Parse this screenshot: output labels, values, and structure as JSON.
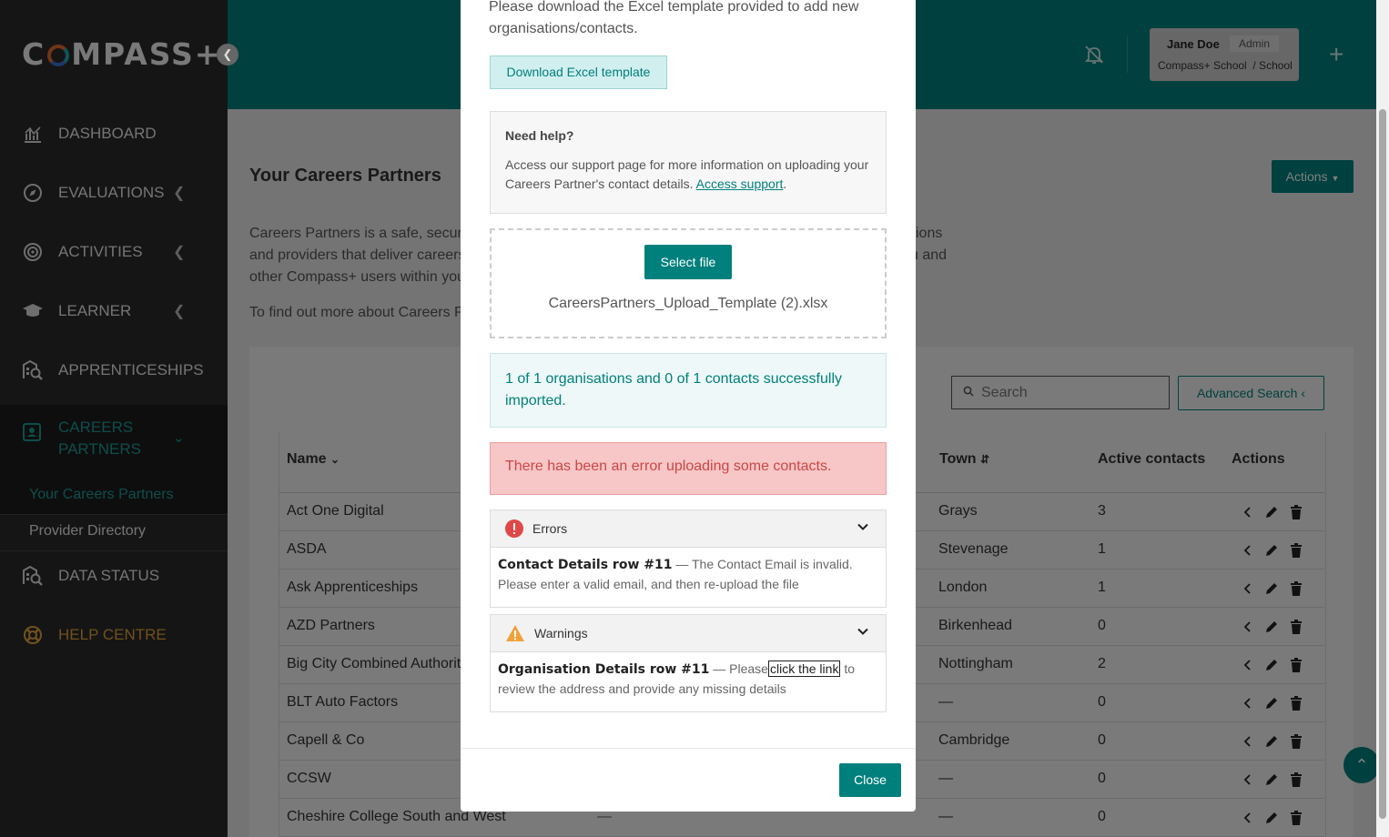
{
  "brand": {
    "logo_left": "C",
    "logo_right": "MPASS+"
  },
  "sidebar": {
    "items": [
      {
        "label": "DASHBOARD",
        "icon": "chart-icon"
      },
      {
        "label": "EVALUATIONS",
        "icon": "compass-icon"
      },
      {
        "label": "ACTIVITIES",
        "icon": "target-icon"
      },
      {
        "label": "LEARNER",
        "icon": "graduation-cap-icon"
      },
      {
        "label": "APPRENTICESHIPS",
        "icon": "building-search-icon"
      },
      {
        "label": "CAREERS PARTNERS",
        "icon": "contact-card-icon"
      },
      {
        "label": "DATA STATUS",
        "icon": "building-search-icon"
      },
      {
        "label": "HELP CENTRE",
        "icon": "lifebuoy-icon"
      }
    ],
    "sub_items": [
      "Your Careers Partners",
      "Provider Directory"
    ]
  },
  "header": {
    "user_name": "Jane Doe",
    "user_role": "Admin",
    "user_school": "Compass+ School",
    "user_school_suffix": "/ School"
  },
  "page": {
    "title": "Your Careers Partners",
    "actions_label": "Actions",
    "intro_lines": [
      {
        "left": "Careers Partners is a safe, secur",
        "right": "ions"
      },
      {
        "left": "and providers that deliver careers",
        "right": "u and"
      },
      {
        "left": "other Compass+ users within you",
        "right": ""
      }
    ],
    "find_out": "To find out more about Careers P",
    "search_placeholder": "Search",
    "advanced_search": "Advanced Search"
  },
  "table": {
    "headers": {
      "name": "Name",
      "town": "Town",
      "active_contacts": "Active contacts",
      "actions": "Actions"
    },
    "rows": [
      {
        "name": "Act One Digital",
        "town": "Grays",
        "contacts": "3"
      },
      {
        "name": "ASDA",
        "town": "Stevenage",
        "contacts": "1"
      },
      {
        "name": "Ask Apprenticeships",
        "town": "London",
        "contacts": "1"
      },
      {
        "name": "AZD Partners",
        "town": "Birkenhead",
        "contacts": "0"
      },
      {
        "name": "Big City Combined Authorit",
        "town": "Nottingham",
        "contacts": "2"
      },
      {
        "name": "BLT Auto Factors",
        "town": "—",
        "contacts": "0"
      },
      {
        "name": "Capell & Co",
        "town": "Cambridge",
        "contacts": "0"
      },
      {
        "name": "CCSW",
        "town": "—",
        "contacts": "0"
      },
      {
        "name": "Cheshire College South and West",
        "extra": "—",
        "town": "—",
        "contacts": "0"
      }
    ]
  },
  "modal": {
    "intro": "Please download the Excel template provided to add new organisations/contacts.",
    "download_label": "Download Excel template",
    "help_title": "Need help?",
    "help_text": "Access our support page for more information on uploading your Careers Partner's contact details.",
    "help_link": "Access support",
    "help_tail": ".",
    "select_file": "Select file",
    "file_name": "CareersPartners_Upload_Template (2).xlsx",
    "success": "1 of 1 organisations and 0 of 1 contacts successfully imported.",
    "error_alert": "There has been an error uploading some contacts.",
    "errors_title": "Errors",
    "error_row": "Contact Details row #11",
    "error_text": "— The Contact Email is invalid. Please enter a valid email, and then re-upload the file",
    "warnings_title": "Warnings",
    "warning_row": "Organisation Details row #11",
    "warning_pre": "— Please",
    "warning_link": "click the link",
    "warning_post": "to review the address and provide any missing details",
    "close_label": "Close"
  },
  "colors": {
    "primary": "#00807c",
    "sidebar": "#2a2a2a",
    "error": "#cc4646",
    "warning": "#f0a13a"
  }
}
